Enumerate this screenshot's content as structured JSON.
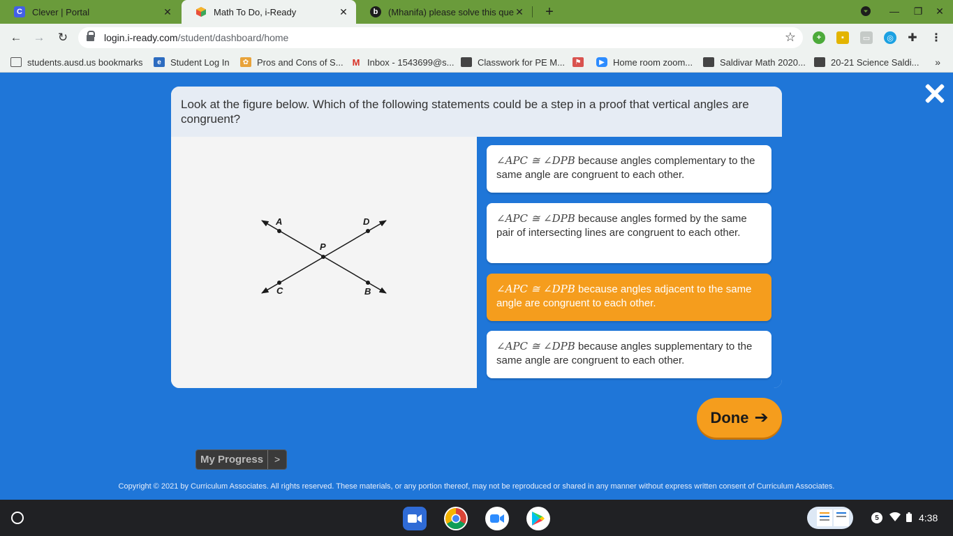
{
  "browser": {
    "tabs": [
      {
        "title": "Clever | Portal",
        "icon": "clever-icon",
        "icon_letter": "C",
        "active": false
      },
      {
        "title": "Math To Do, i-Ready",
        "icon": "iready-icon",
        "active": true
      },
      {
        "title": "(Mhanifa) please solve this ques",
        "icon": "brainly-icon",
        "active": false
      }
    ],
    "address": {
      "domain": "login.i-ready.com",
      "path": "/student/dashboard/home"
    },
    "bookmarks": [
      {
        "label": "students.ausd.us bookmarks",
        "icon": "folder-icon"
      },
      {
        "label": "Student Log In",
        "icon": "e-icon",
        "icon_letter": "e"
      },
      {
        "label": "Pros and Cons of S...",
        "icon": "paw-icon"
      },
      {
        "label": "Inbox - 1543699@s...",
        "icon": "gmail-icon",
        "icon_letter": "M"
      },
      {
        "label": "Classwork for PE M...",
        "icon": "classroom-icon"
      },
      {
        "label": "",
        "icon": "flag-icon"
      },
      {
        "label": "Home room zoom...",
        "icon": "zoom-icon"
      },
      {
        "label": "Saldivar Math 2020...",
        "icon": "classroom-icon"
      },
      {
        "label": "20-21 Science Saldi...",
        "icon": "classroom-icon"
      }
    ],
    "bookmarks_more": "»"
  },
  "question": {
    "prompt": "Look at the figure below. Which of the following statements could be a step in a proof that vertical angles are congruent?",
    "figure": {
      "labels": {
        "A": "A",
        "D": "D",
        "P": "P",
        "C": "C",
        "B": "B"
      }
    },
    "choices": [
      {
        "math": "∠APC ≅ ∠DPB",
        "text": " because angles complementary to the same angle are congruent to each other.",
        "selected": false
      },
      {
        "math": "∠APC ≅ ∠DPB",
        "text": " because angles formed by the same pair of intersecting lines are congruent to each other.",
        "selected": false
      },
      {
        "math": "∠APC ≅ ∠DPB",
        "text": " because angles adjacent to the same angle are congruent to each other.",
        "selected": true
      },
      {
        "math": "∠APC ≅ ∠DPB",
        "text": " because angles supplementary to the same angle are congruent to each other.",
        "selected": false
      }
    ]
  },
  "done_label": "Done",
  "my_progress": {
    "label": "My Progress",
    "chevron": ">"
  },
  "copyright": "Copyright © 2021 by Curriculum Associates. All rights reserved. These materials, or any portion thereof, may not be reproduced or shared in any manner without express written consent of Curriculum Associates.",
  "shelf": {
    "apps": [
      "camera-icon",
      "chrome-icon",
      "zoom-icon",
      "play-store-icon"
    ],
    "notifications": "5",
    "time": "4:38"
  },
  "colors": {
    "page_bg": "#1f76d8",
    "selected_choice": "#f59d1d",
    "tabstrip": "#6a9b3b"
  }
}
